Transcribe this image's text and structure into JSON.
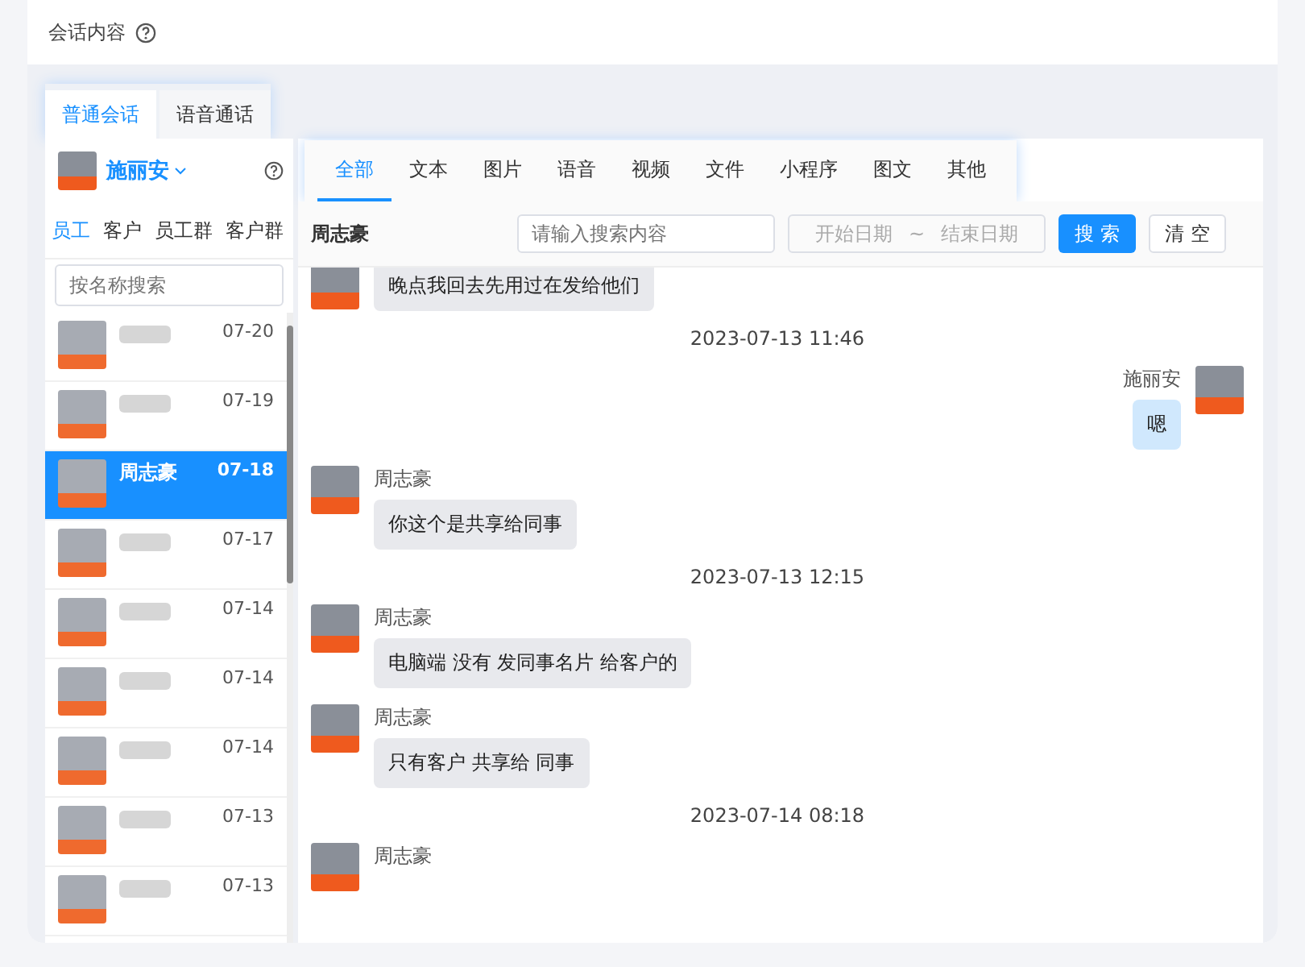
{
  "header": {
    "title": "会话内容"
  },
  "mode_tabs": [
    {
      "label": "普通会话",
      "selected": true
    },
    {
      "label": "语音通话",
      "selected": false
    }
  ],
  "account": {
    "name": "施丽安"
  },
  "category_tabs": [
    {
      "label": "员工",
      "selected": true
    },
    {
      "label": "客户",
      "selected": false
    },
    {
      "label": "员工群",
      "selected": false
    },
    {
      "label": "客户群",
      "selected": false
    }
  ],
  "contact_search": {
    "placeholder": "按名称搜索"
  },
  "contacts": [
    {
      "date": "07-20",
      "selected": false
    },
    {
      "date": "07-19",
      "selected": false
    },
    {
      "name": "周志豪",
      "date": "07-18",
      "selected": true
    },
    {
      "date": "07-17",
      "selected": false
    },
    {
      "date": "07-14",
      "selected": false
    },
    {
      "date": "07-14",
      "selected": false
    },
    {
      "date": "07-14",
      "selected": false
    },
    {
      "date": "07-13",
      "selected": false
    },
    {
      "date": "07-13",
      "selected": false
    }
  ],
  "type_tabs": [
    {
      "label": "全部",
      "selected": true
    },
    {
      "label": "文本",
      "selected": false
    },
    {
      "label": "图片",
      "selected": false
    },
    {
      "label": "语音",
      "selected": false
    },
    {
      "label": "视频",
      "selected": false
    },
    {
      "label": "文件",
      "selected": false
    },
    {
      "label": "小程序",
      "selected": false
    },
    {
      "label": "图文",
      "selected": false
    },
    {
      "label": "其他",
      "selected": false
    }
  ],
  "filter": {
    "contact": "周志豪",
    "search_placeholder": "请输入搜索内容",
    "start_placeholder": "开始日期",
    "separator": "~",
    "end_placeholder": "结束日期",
    "search_button": "搜 索",
    "clear_button": "清 空"
  },
  "messages": [
    {
      "kind": "incoming",
      "text": "晚点我回去先用过在发给他们"
    },
    {
      "kind": "time",
      "text": "2023-07-13 11:46"
    },
    {
      "kind": "outgoing",
      "sender": "施丽安",
      "text": "嗯"
    },
    {
      "kind": "incoming",
      "sender": "周志豪",
      "text": "你这个是共享给同事"
    },
    {
      "kind": "time",
      "text": "2023-07-13 12:15"
    },
    {
      "kind": "incoming",
      "sender": "周志豪",
      "text": "电脑端 没有 发同事名片 给客户的"
    },
    {
      "kind": "incoming",
      "sender": "周志豪",
      "text": "只有客户 共享给 同事"
    },
    {
      "kind": "time",
      "text": "2023-07-14 08:18"
    },
    {
      "kind": "incoming",
      "sender": "周志豪"
    }
  ]
}
